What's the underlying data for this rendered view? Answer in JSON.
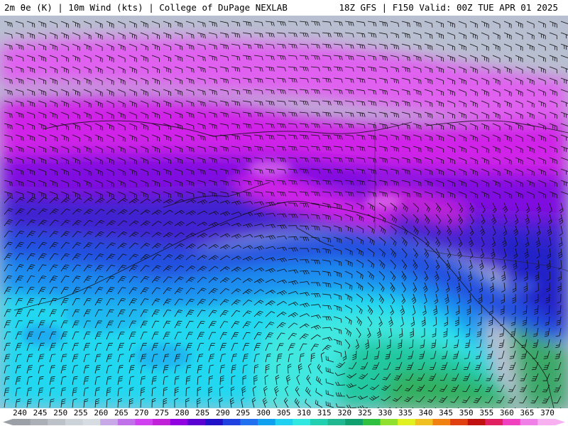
{
  "header": {
    "left_title": "2m θe (K) | 10m Wind (kts) | College of DuPage NEXLAB",
    "right_title": "18Z GFS | F150 Valid: 00Z TUE APR 01 2025"
  },
  "legend": {
    "unit": "K",
    "ticks": [
      "240",
      "245",
      "250",
      "255",
      "260",
      "265",
      "270",
      "275",
      "280",
      "285",
      "290",
      "295",
      "300",
      "305",
      "310",
      "315",
      "320",
      "325",
      "330",
      "335",
      "340",
      "345",
      "350",
      "355",
      "360",
      "365",
      "370"
    ],
    "colors": [
      "#9aa0a6",
      "#aab0b6",
      "#bcc2c8",
      "#cbd2d8",
      "#d6dce2",
      "#c8a8e6",
      "#c070e8",
      "#d040f0",
      "#c020d8",
      "#9000e0",
      "#5a00d0",
      "#2010c8",
      "#2040e0",
      "#2070f0",
      "#10a0f0",
      "#20d0f0",
      "#30e8e0",
      "#20d0b0",
      "#20b890",
      "#10a070",
      "#30c040",
      "#90e030",
      "#e0f020",
      "#f0c020",
      "#f08010",
      "#e04010",
      "#c01010",
      "#e02060",
      "#f040c0",
      "#f080e8",
      "#f8b0f0"
    ]
  },
  "map_layers": {
    "fill_field": "2m theta-e",
    "vector_field": "10m wind barbs",
    "region": "Gulf of Alaska / Alaska / Bering Sea",
    "background_colors": {
      "arctic_gray": "#b8bfd0",
      "pink": "#e060f0",
      "magenta": "#d020e8",
      "violet": "#8010e0",
      "blue_violet": "#4020d0",
      "blue": "#2050e0",
      "mid_blue": "#1a8ef0",
      "cyan": "#20d8f0",
      "aqua": "#40e8e0",
      "teal_green": "#20c8a0",
      "green": "#30b060"
    }
  }
}
